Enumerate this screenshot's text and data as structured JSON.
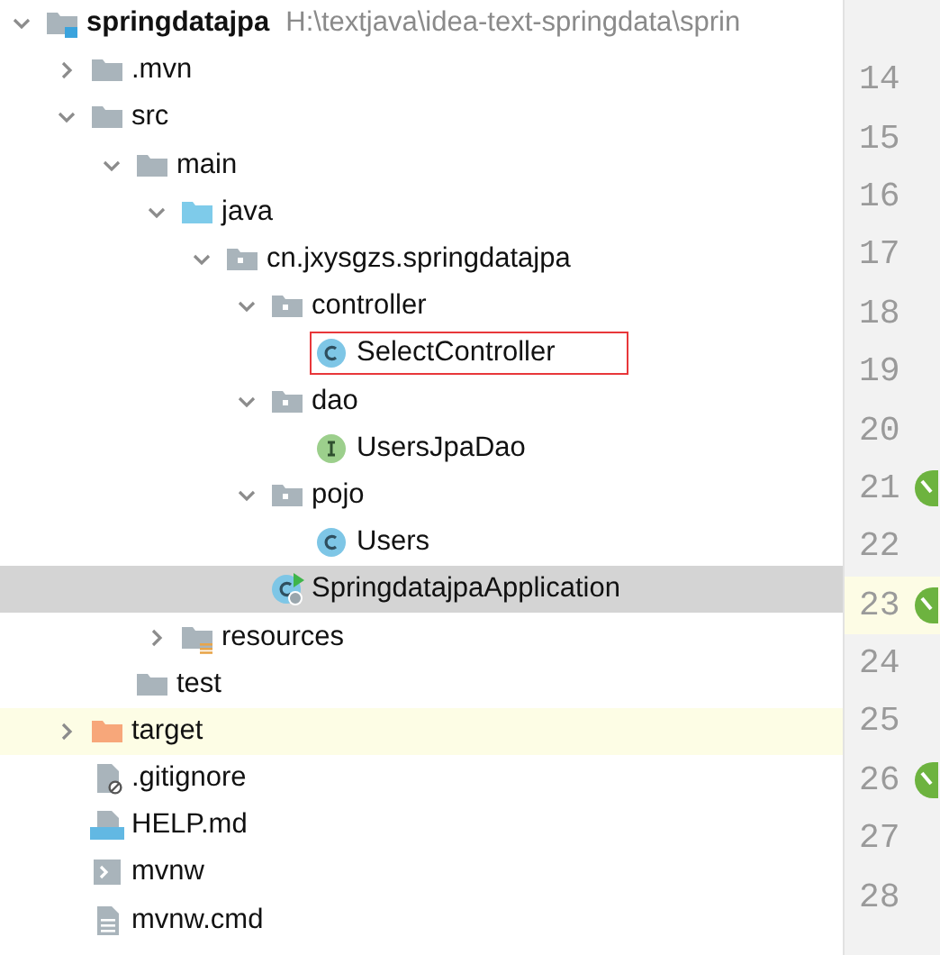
{
  "project_tree": {
    "name": "springdatajpa",
    "path": "H:\\textjava\\idea-text-springdata\\sprin",
    "kind": "module",
    "expanded": true,
    "selected": false,
    "highlighted": false,
    "marked": false,
    "children": [
      {
        "name": ".mvn",
        "kind": "folder",
        "expanded": false,
        "selected": false,
        "highlighted": false,
        "marked": false
      },
      {
        "name": "src",
        "kind": "folder",
        "expanded": true,
        "selected": false,
        "highlighted": false,
        "marked": false,
        "children": [
          {
            "name": "main",
            "kind": "folder",
            "expanded": true,
            "selected": false,
            "highlighted": false,
            "marked": false,
            "children": [
              {
                "name": "java",
                "kind": "source-folder",
                "expanded": true,
                "selected": false,
                "highlighted": false,
                "marked": false,
                "children": [
                  {
                    "name": "cn.jxysgzs.springdatajpa",
                    "kind": "package",
                    "expanded": true,
                    "selected": false,
                    "highlighted": false,
                    "marked": false,
                    "children": [
                      {
                        "name": "controller",
                        "kind": "package",
                        "expanded": true,
                        "selected": false,
                        "highlighted": false,
                        "marked": false,
                        "children": [
                          {
                            "name": "SelectController",
                            "kind": "class",
                            "selected": false,
                            "highlighted": false,
                            "marked": true
                          }
                        ]
                      },
                      {
                        "name": "dao",
                        "kind": "package",
                        "expanded": true,
                        "selected": false,
                        "highlighted": false,
                        "marked": false,
                        "children": [
                          {
                            "name": "UsersJpaDao",
                            "kind": "interface",
                            "selected": false,
                            "highlighted": false,
                            "marked": false
                          }
                        ]
                      },
                      {
                        "name": "pojo",
                        "kind": "package",
                        "expanded": true,
                        "selected": false,
                        "highlighted": false,
                        "marked": false,
                        "children": [
                          {
                            "name": "Users",
                            "kind": "class",
                            "selected": false,
                            "highlighted": false,
                            "marked": false
                          }
                        ]
                      },
                      {
                        "name": "SpringdatajpaApplication",
                        "kind": "spring-app",
                        "selected": true,
                        "highlighted": false,
                        "marked": false
                      }
                    ]
                  }
                ]
              },
              {
                "name": "resources",
                "kind": "resources-folder",
                "expanded": false,
                "selected": false,
                "highlighted": false,
                "marked": false
              }
            ]
          },
          {
            "name": "test",
            "kind": "folder",
            "selected": false,
            "highlighted": false,
            "marked": false
          }
        ]
      },
      {
        "name": "target",
        "kind": "excluded-folder",
        "expanded": false,
        "selected": false,
        "highlighted": true,
        "marked": false
      },
      {
        "name": ".gitignore",
        "kind": "ignore-file",
        "selected": false,
        "highlighted": false,
        "marked": false
      },
      {
        "name": "HELP.md",
        "kind": "markdown-file",
        "selected": false,
        "highlighted": false,
        "marked": false
      },
      {
        "name": "mvnw",
        "kind": "shell-file",
        "selected": false,
        "highlighted": false,
        "marked": false
      },
      {
        "name": "mvnw.cmd",
        "kind": "text-file",
        "selected": false,
        "highlighted": false,
        "marked": false
      }
    ]
  },
  "editor_gutter": {
    "lines": [
      {
        "number": "14",
        "current": false,
        "bean": false
      },
      {
        "number": "15",
        "current": false,
        "bean": false
      },
      {
        "number": "16",
        "current": false,
        "bean": false
      },
      {
        "number": "17",
        "current": false,
        "bean": false
      },
      {
        "number": "18",
        "current": false,
        "bean": false
      },
      {
        "number": "19",
        "current": false,
        "bean": false
      },
      {
        "number": "20",
        "current": false,
        "bean": false
      },
      {
        "number": "21",
        "current": false,
        "bean": true
      },
      {
        "number": "22",
        "current": false,
        "bean": false
      },
      {
        "number": "23",
        "current": true,
        "bean": true
      },
      {
        "number": "24",
        "current": false,
        "bean": false
      },
      {
        "number": "25",
        "current": false,
        "bean": false
      },
      {
        "number": "26",
        "current": false,
        "bean": true
      },
      {
        "number": "27",
        "current": false,
        "bean": false
      },
      {
        "number": "28",
        "current": false,
        "bean": false
      }
    ]
  }
}
